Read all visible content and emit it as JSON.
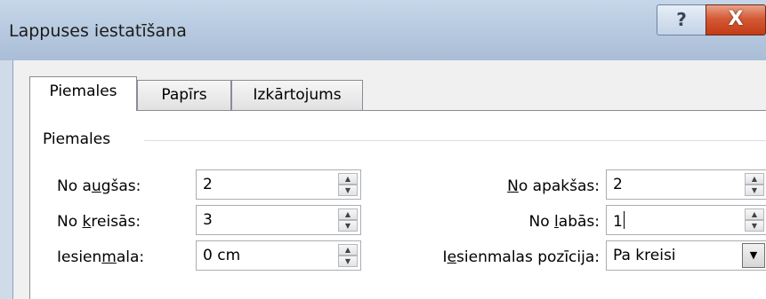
{
  "window": {
    "title": "Lappuses iestatīšana",
    "help_label": "?",
    "close_label": "X"
  },
  "tabs": [
    {
      "label": "Piemales",
      "active": true
    },
    {
      "label": "Papīrs",
      "active": false
    },
    {
      "label": "Izkārtojums",
      "active": false
    }
  ],
  "margins": {
    "group_label": "Piemales",
    "top": {
      "label_pre": "No a",
      "label_u": "u",
      "label_post": "gšas:",
      "value": "2"
    },
    "bottom": {
      "label_pre": "",
      "label_u": "N",
      "label_post": "o apakšas:",
      "value": "2"
    },
    "left": {
      "label_pre": "No ",
      "label_u": "k",
      "label_post": "reisās:",
      "value": "3"
    },
    "right": {
      "label_pre": "No ",
      "label_u": "l",
      "label_post": "abās:",
      "value": "1"
    },
    "gutter": {
      "label_pre": "Iesien",
      "label_u": "m",
      "label_post": "ala:",
      "value": "0 cm"
    },
    "gutter_position": {
      "label_pre": "I",
      "label_u": "e",
      "label_post": "sienmalas pozīcija:",
      "value": "Pa kreisi"
    }
  },
  "icons": {
    "spin_up": "▲",
    "spin_down": "▼",
    "dropdown": "▼"
  }
}
